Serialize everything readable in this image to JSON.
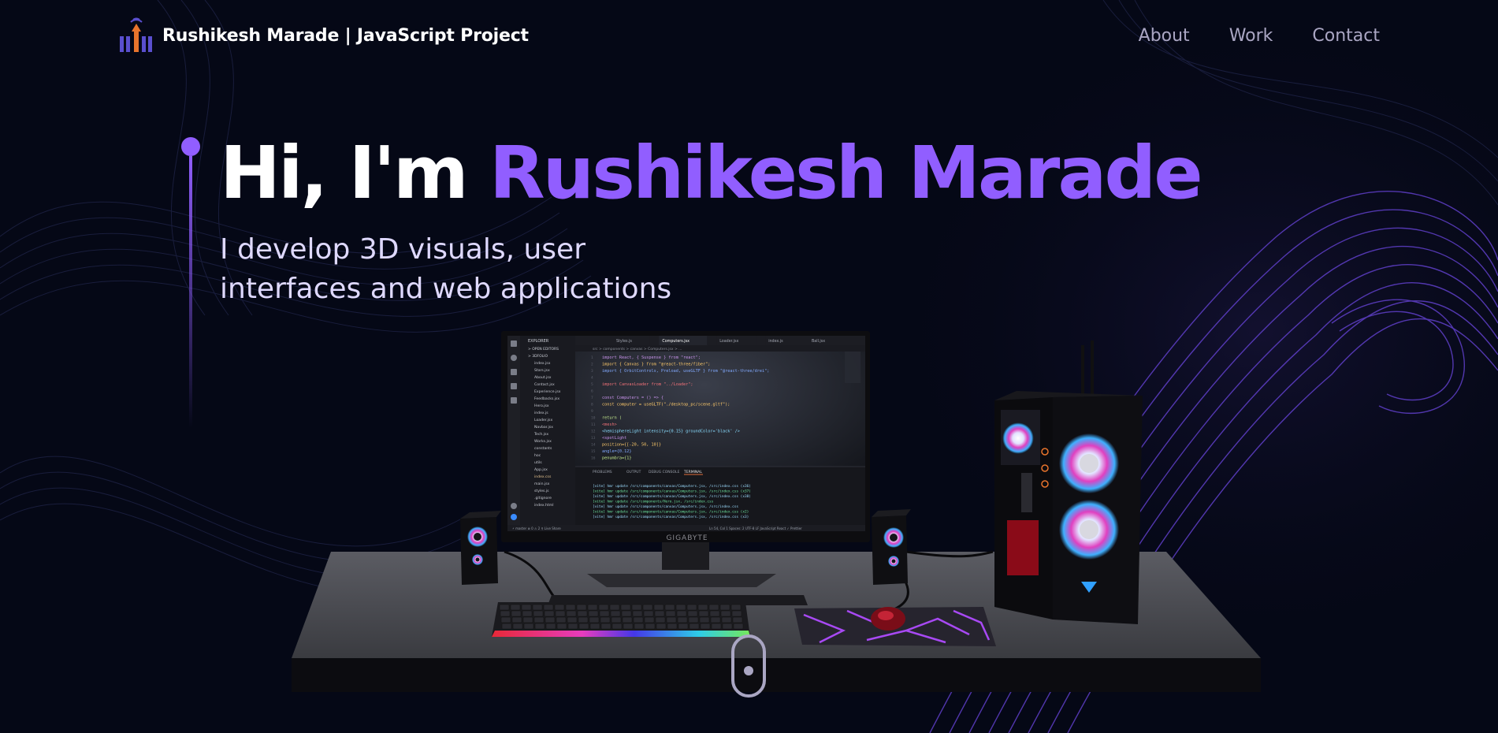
{
  "navbar": {
    "brand": "Rushikesh Marade  | JavaScript Project",
    "logo_icon": "rm-logo-icon",
    "links": [
      "About",
      "Work",
      "Contact"
    ]
  },
  "hero": {
    "greeting": "Hi, I'm ",
    "name": "Rushikesh Marade",
    "subtitle_line1": "I develop 3D visuals, user",
    "subtitle_line2": "interfaces and web applications"
  },
  "monitor": {
    "brand": "GIGABYTE",
    "tabs": [
      "Styles.js",
      "Computers.jsx",
      "Loader.jsx",
      "index.js",
      "Ball.jsx"
    ],
    "code_lines": [
      "import React, { Suspense } from \"react\";",
      "import { Canvas } from \"@react-three/fiber\";",
      "import { OrbitControls, Preload, useGLTF } from \"@react-three/drei\";",
      "",
      "import CanvasLoader from \"../Loader\";",
      "",
      "const Computers = () => {",
      "  const computer = useGLTF(\"./desktop_pc/scene.gltf\");",
      "",
      "  return (",
      "    <mesh>",
      "      <hemisphereLight intensity={0.15} groundColor='black' />",
      "      <spotLight",
      "        position={[-20, 50, 10]}",
      "        angle={0.12}",
      "        penumbra={1}"
    ],
    "terminal_lines": [
      "[vite] hmr update /src/components/canvas/Computers.jsx, /src/index.css (x36)",
      "[vite] hmr update /src/components/canvas/Computers.jsx, /src/index.css (x37)",
      "[vite] hmr update /src/components/canvas/Computers.jsx, /src/index.css (x38)",
      "[vite] hmr update /src/components/Hero.jsx, /src/index.css",
      "[vite] hmr update /src/components/canvas/Computers.jsx, /src/index.css",
      "[vite] hmr update /src/components/canvas/Computers.jsx, /src/index.css (x2)",
      "[vite] hmr update /src/components/canvas/Computers.jsx, /src/index.css (x3)"
    ],
    "explorer_files": [
      "index.jsx",
      "Stars.jsx",
      "About.jsx",
      "Contact.jsx",
      "Experience.jsx",
      "Feedbacks.jsx",
      "Hero.jsx",
      "index.js",
      "Loader.jsx",
      "Navbar.jsx",
      "Tech.jsx",
      "Works.jsx",
      "constants",
      "hoc",
      "utils",
      "App.jsx",
      "index.css",
      "main.jsx",
      "styles.js",
      ".gitignore",
      "index.html"
    ]
  },
  "colors": {
    "background": "#050816",
    "accent": "#915eff",
    "nav_text": "#aaa6c3",
    "subtitle": "#dfd9ff"
  },
  "scroll": {
    "icon": "mouse-scroll-icon"
  }
}
